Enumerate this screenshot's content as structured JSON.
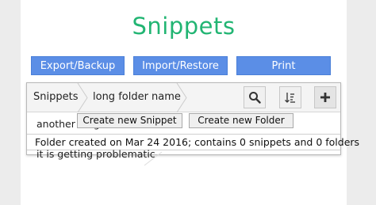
{
  "app": {
    "title": "Snippets"
  },
  "actions": {
    "export_label": "Export/Backup",
    "import_label": "Import/Restore",
    "print_label": "Print"
  },
  "breadcrumb": {
    "items": [
      {
        "label": "Snippets"
      },
      {
        "label": "long folder name"
      }
    ]
  },
  "toolbar": {
    "search_icon": "search-icon",
    "sort_icon": "sort-icon",
    "add_icon": "plus-icon"
  },
  "content": {
    "folder_row_text": "another long folder",
    "new_snippet_label": "Create new Snippet",
    "new_folder_label": "Create new Folder",
    "status_text": "Folder created on Mar 24 2016; contains 0 snippets and 0 folders",
    "bottom_row_text": "it is getting problematic"
  },
  "colors": {
    "title_green": "#22b573",
    "button_blue": "#5b8ee6",
    "side_gray": "#ececec"
  }
}
